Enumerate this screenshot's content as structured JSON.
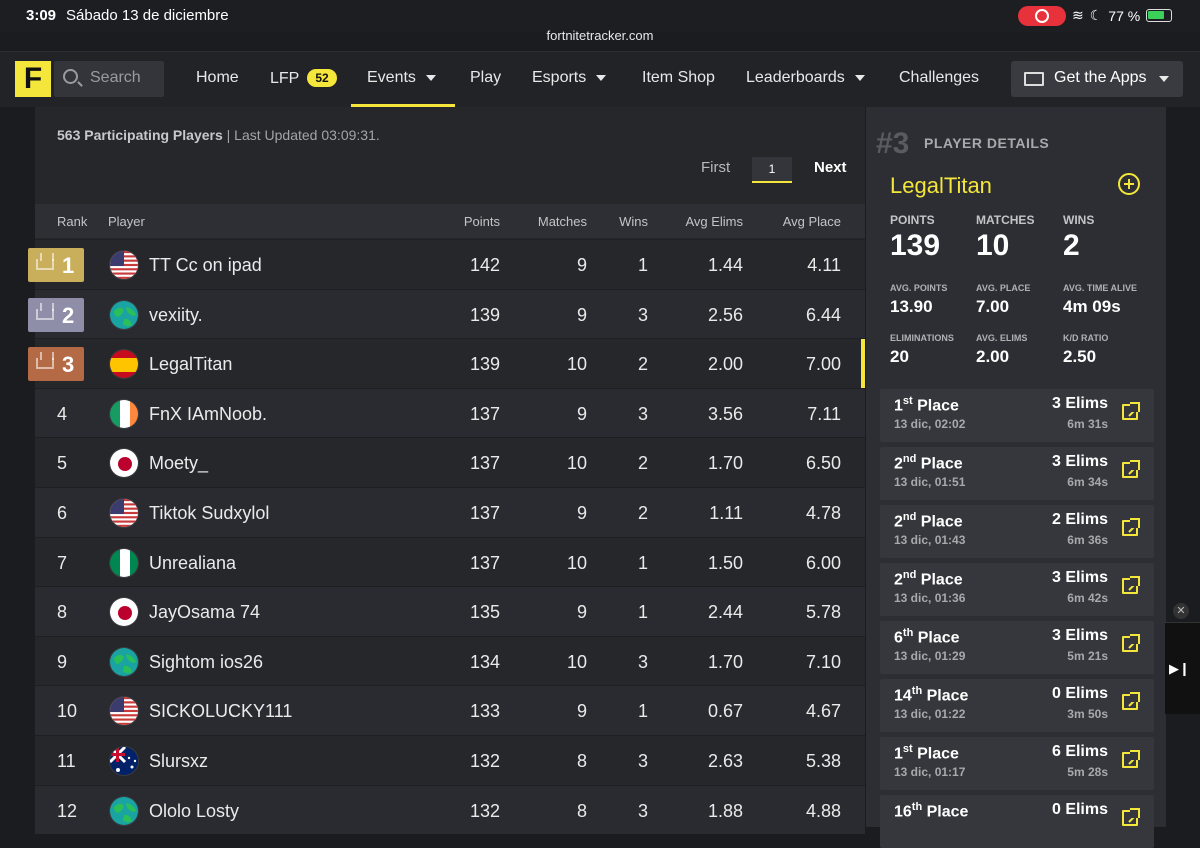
{
  "status_bar": {
    "time": "3:09",
    "date": "Sábado 13 de diciembre",
    "battery": "77 %"
  },
  "url": "fortnitetracker.com",
  "nav": {
    "logo": "F",
    "search_placeholder": "Search",
    "items": [
      {
        "label": "Home"
      },
      {
        "label": "LFP",
        "badge": "52"
      },
      {
        "label": "Events",
        "dropdown": true,
        "active": true
      },
      {
        "label": "Play"
      },
      {
        "label": "Esports",
        "dropdown": true
      },
      {
        "label": "Item Shop"
      },
      {
        "label": "Leaderboards",
        "dropdown": true
      },
      {
        "label": "Challenges"
      }
    ],
    "apps_label": "Get the Apps"
  },
  "leaderboard": {
    "participants": "563 Participating Players",
    "updated": " | Last Updated 03:09:31.",
    "pager": {
      "first": "First",
      "page": "1",
      "next": "Next"
    },
    "columns": [
      "Rank",
      "Player",
      "Points",
      "Matches",
      "Wins",
      "Avg Elims",
      "Avg Place"
    ],
    "rank_colors": {
      "1": "#c9ae5b",
      "2": "#8e8ea8",
      "3": "#b46a45"
    },
    "rows": [
      {
        "rank": "1",
        "flag": "us",
        "player": "TT Cc on ipad",
        "points": "142",
        "matches": "9",
        "wins": "1",
        "avg_elims": "1.44",
        "avg_place": "4.11"
      },
      {
        "rank": "2",
        "flag": "globe",
        "player": "vexiity.",
        "points": "139",
        "matches": "9",
        "wins": "3",
        "avg_elims": "2.56",
        "avg_place": "6.44"
      },
      {
        "rank": "3",
        "flag": "es",
        "player": "LegalTitan",
        "points": "139",
        "matches": "10",
        "wins": "2",
        "avg_elims": "2.00",
        "avg_place": "7.00"
      },
      {
        "rank": "4",
        "flag": "ie",
        "player": "FnX IAmNoob.",
        "points": "137",
        "matches": "9",
        "wins": "3",
        "avg_elims": "3.56",
        "avg_place": "7.11"
      },
      {
        "rank": "5",
        "flag": "jp",
        "player": "Moety_",
        "points": "137",
        "matches": "10",
        "wins": "2",
        "avg_elims": "1.70",
        "avg_place": "6.50"
      },
      {
        "rank": "6",
        "flag": "us",
        "player": "Tiktok Sudxylol",
        "points": "137",
        "matches": "9",
        "wins": "2",
        "avg_elims": "1.11",
        "avg_place": "4.78"
      },
      {
        "rank": "7",
        "flag": "ng",
        "player": "Unrealiana",
        "points": "137",
        "matches": "10",
        "wins": "1",
        "avg_elims": "1.50",
        "avg_place": "6.00"
      },
      {
        "rank": "8",
        "flag": "jp",
        "player": "JayOsama 74",
        "points": "135",
        "matches": "9",
        "wins": "1",
        "avg_elims": "2.44",
        "avg_place": "5.78"
      },
      {
        "rank": "9",
        "flag": "globe",
        "player": "Sightom ios26",
        "points": "134",
        "matches": "10",
        "wins": "3",
        "avg_elims": "1.70",
        "avg_place": "7.10"
      },
      {
        "rank": "10",
        "flag": "us",
        "player": "SICKOLUCKY111",
        "points": "133",
        "matches": "9",
        "wins": "1",
        "avg_elims": "0.67",
        "avg_place": "4.67"
      },
      {
        "rank": "11",
        "flag": "au",
        "player": "Slursxz",
        "points": "132",
        "matches": "8",
        "wins": "3",
        "avg_elims": "2.63",
        "avg_place": "5.38"
      },
      {
        "rank": "12",
        "flag": "globe",
        "player": "Ololo Losty",
        "points": "132",
        "matches": "8",
        "wins": "3",
        "avg_elims": "1.88",
        "avg_place": "4.88"
      }
    ]
  },
  "details": {
    "rank": "#3",
    "header": "PLAYER DETAILS",
    "name": "LegalTitan",
    "big_stats": [
      {
        "label": "POINTS",
        "value": "139"
      },
      {
        "label": "MATCHES",
        "value": "10"
      },
      {
        "label": "WINS",
        "value": "2"
      }
    ],
    "small_stats": [
      {
        "label": "AVG. POINTS",
        "value": "13.90"
      },
      {
        "label": "AVG. PLACE",
        "value": "7.00"
      },
      {
        "label": "AVG. TIME ALIVE",
        "value": "4m 09s"
      },
      {
        "label": "ELIMINATIONS",
        "value": "20"
      },
      {
        "label": "AVG. ELIMS",
        "value": "2.00"
      },
      {
        "label": "K/D RATIO",
        "value": "2.50"
      }
    ],
    "matches": [
      {
        "place_num": "1",
        "place_suffix": "st",
        "place_word": " Place",
        "date": "13 dic, 02:02",
        "elims": "3 Elims",
        "time": "6m 31s"
      },
      {
        "place_num": "2",
        "place_suffix": "nd",
        "place_word": " Place",
        "date": "13 dic, 01:51",
        "elims": "3 Elims",
        "time": "6m 34s"
      },
      {
        "place_num": "2",
        "place_suffix": "nd",
        "place_word": " Place",
        "date": "13 dic, 01:43",
        "elims": "2 Elims",
        "time": "6m 36s"
      },
      {
        "place_num": "2",
        "place_suffix": "nd",
        "place_word": " Place",
        "date": "13 dic, 01:36",
        "elims": "3 Elims",
        "time": "6m 42s"
      },
      {
        "place_num": "6",
        "place_suffix": "th",
        "place_word": " Place",
        "date": "13 dic, 01:29",
        "elims": "3 Elims",
        "time": "5m 21s"
      },
      {
        "place_num": "14",
        "place_suffix": "th",
        "place_word": " Place",
        "date": "13 dic, 01:22",
        "elims": "0 Elims",
        "time": "3m 50s"
      },
      {
        "place_num": "1",
        "place_suffix": "st",
        "place_word": " Place",
        "date": "13 dic, 01:17",
        "elims": "6 Elims",
        "time": "5m 28s"
      },
      {
        "place_num": "16",
        "place_suffix": "th",
        "place_word": " Place",
        "date": "",
        "elims": "0 Elims",
        "time": ""
      }
    ]
  }
}
